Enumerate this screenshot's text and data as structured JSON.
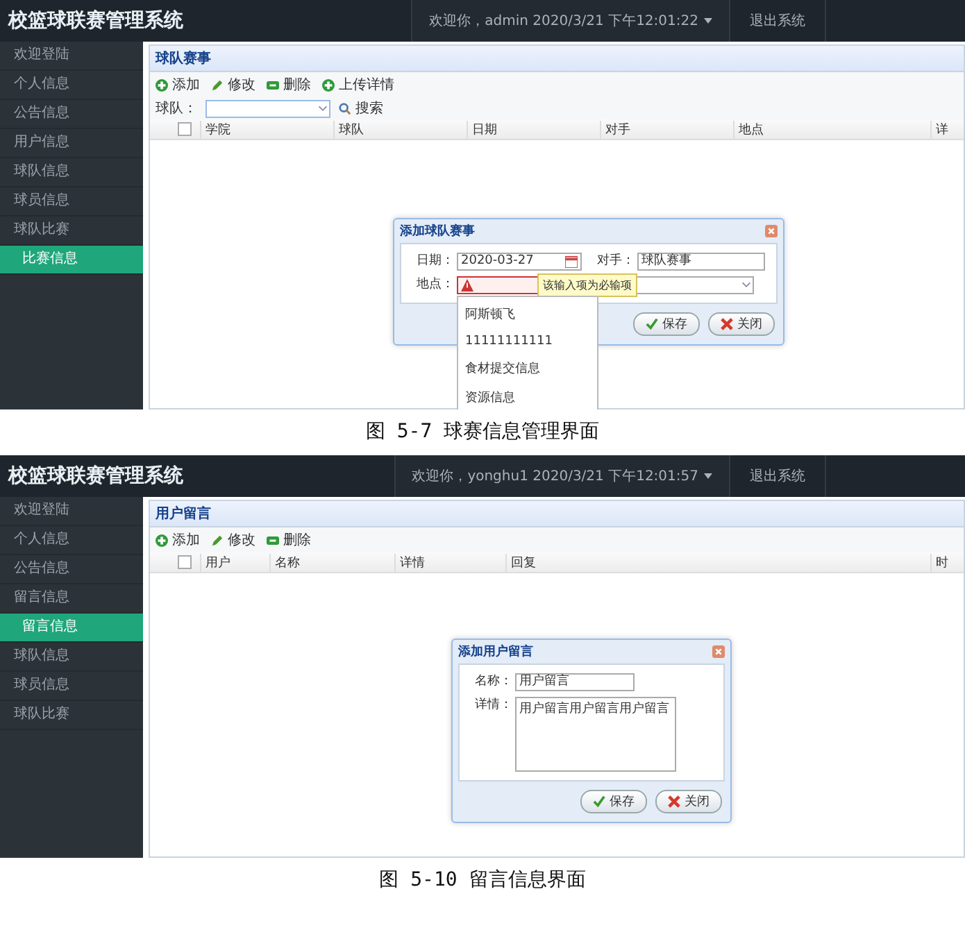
{
  "screens": [
    {
      "app_title": "校篮球联赛管理系统",
      "user_info": "欢迎你，admin  2020/3/21 下午12:01:22",
      "logout": "退出系统",
      "sidebar": [
        {
          "label": "欢迎登陆",
          "selected": false
        },
        {
          "label": "个人信息",
          "selected": false
        },
        {
          "label": "公告信息",
          "selected": false
        },
        {
          "label": "用户信息",
          "selected": false
        },
        {
          "label": "球队信息",
          "selected": false
        },
        {
          "label": "球员信息",
          "selected": false
        },
        {
          "label": "球队比赛",
          "selected": false
        },
        {
          "label": "比赛信息",
          "selected": true
        }
      ],
      "panel_title": "球队赛事",
      "toolbar": [
        {
          "label": "添加",
          "kind": "add"
        },
        {
          "label": "修改",
          "kind": "edit"
        },
        {
          "label": "删除",
          "kind": "delete"
        },
        {
          "label": "上传详情",
          "kind": "add"
        }
      ],
      "search": {
        "label": "球队：",
        "button": "搜索"
      },
      "select_all_checked": false,
      "columns": [
        "学院",
        "球队",
        "日期",
        "对手",
        "地点",
        "详"
      ],
      "dialog": {
        "title": "添加球队赛事",
        "rows": [
          [
            {
              "label": "日期：",
              "kind": "date",
              "value": "2020-03-27"
            },
            {
              "label": "对手：",
              "kind": "text",
              "value": "球队赛事"
            }
          ],
          [
            {
              "label": "地点：",
              "kind": "text",
              "error": true,
              "tooltip": "该输入项为必输项",
              "options": [
                "阿斯顿飞",
                "11111111111",
                "食材提交信息",
                "资源信息"
              ]
            },
            {
              "kind": "select"
            }
          ]
        ],
        "buttons": [
          {
            "label": "保存",
            "kind": "save"
          },
          {
            "label": "关闭",
            "kind": "close"
          }
        ]
      },
      "caption": "图 5-7 球赛信息管理界面"
    },
    {
      "app_title": "校篮球联赛管理系统",
      "user_info": "欢迎你，yonghu1  2020/3/21 下午12:01:57",
      "logout": "退出系统",
      "sidebar": [
        {
          "label": "欢迎登陆",
          "selected": false
        },
        {
          "label": "个人信息",
          "selected": false
        },
        {
          "label": "公告信息",
          "selected": false
        },
        {
          "label": "留言信息",
          "selected": false
        },
        {
          "label": "留言信息",
          "selected": true
        },
        {
          "label": "球队信息",
          "selected": false
        },
        {
          "label": "球员信息",
          "selected": false
        },
        {
          "label": "球队比赛",
          "selected": false
        }
      ],
      "panel_title": "用户留言",
      "toolbar": [
        {
          "label": "添加",
          "kind": "add"
        },
        {
          "label": "修改",
          "kind": "edit"
        },
        {
          "label": "删除",
          "kind": "delete"
        }
      ],
      "select_all_checked": false,
      "columns": [
        "用户",
        "名称",
        "详情",
        "回复",
        "时"
      ],
      "dialog": {
        "title": "添加用户留言",
        "rows": [
          [
            {
              "label": "名称：",
              "kind": "text",
              "value": "用户留言"
            }
          ],
          [
            {
              "label": "详情：",
              "kind": "textarea",
              "value": "用户留言用户留言用户留言"
            }
          ]
        ],
        "buttons": [
          {
            "label": "保存",
            "kind": "save"
          },
          {
            "label": "关闭",
            "kind": "close"
          }
        ]
      },
      "caption": "图 5-10 留言信息界面"
    }
  ]
}
